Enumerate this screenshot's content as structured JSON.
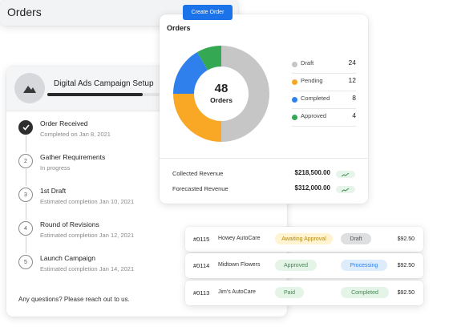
{
  "campaign": {
    "title": "Digital Ads Campaign Setup",
    "avatar_icon": "image-landscape-icon",
    "progress_fraction": 0.85,
    "steps": [
      {
        "number": "",
        "title": "Order Received",
        "subtitle": "Completed on Jan 8, 2021",
        "done": true
      },
      {
        "number": "2",
        "title": "Gather Requirements",
        "subtitle": "In progress",
        "done": false
      },
      {
        "number": "3",
        "title": "1st Draft",
        "subtitle": "Estimated completion Jan 10, 2021",
        "done": false
      },
      {
        "number": "4",
        "title": "Round of Revisions",
        "subtitle": "Estimated completion Jan 12, 2021",
        "done": false
      },
      {
        "number": "5",
        "title": "Launch Campaign",
        "subtitle": "Estimated completion Jan 14, 2021",
        "done": false
      }
    ],
    "footer": "Any questions? Please reach out to us."
  },
  "summary": {
    "title": "Orders",
    "total": "48",
    "total_label": "Orders",
    "revenue": [
      {
        "label": "Collected Revenue",
        "value": "$218,500.00"
      },
      {
        "label": "Forecasted Revenue",
        "value": "$312,000.00"
      }
    ]
  },
  "chart_data": {
    "type": "pie",
    "categories": [
      "Draft",
      "Pending",
      "Completed",
      "Approved"
    ],
    "values": [
      24,
      12,
      8,
      4
    ],
    "colors": [
      "#c6c6c6",
      "#f9a825",
      "#2f80ed",
      "#34a853"
    ],
    "title": "Orders"
  },
  "orders": {
    "title": "Orders",
    "create_label": "Create Order",
    "rows": [
      {
        "id": "#0115",
        "name": "Howey AutoCare",
        "tag": "Awaiting Approval",
        "tag_bg": "#fff4cf",
        "tag_fg": "#b48a18",
        "status": "Draft",
        "status_bg": "#dedfe1",
        "status_fg": "#555555",
        "amount": "$92.50"
      },
      {
        "id": "#0114",
        "name": "Midtown Flowers",
        "tag": "Approved",
        "tag_bg": "#e4f4e7",
        "tag_fg": "#3b8d50",
        "status": "Processing",
        "status_bg": "#dcecfb",
        "status_fg": "#2f80ed",
        "amount": "$92.50"
      },
      {
        "id": "#0113",
        "name": "Jim's AutoCare",
        "tag": "Paid",
        "tag_bg": "#e4f4e7",
        "tag_fg": "#3b8d50",
        "status": "Completed",
        "status_bg": "#e4f4e7",
        "status_fg": "#3b8d50",
        "amount": "$92.50"
      }
    ]
  }
}
